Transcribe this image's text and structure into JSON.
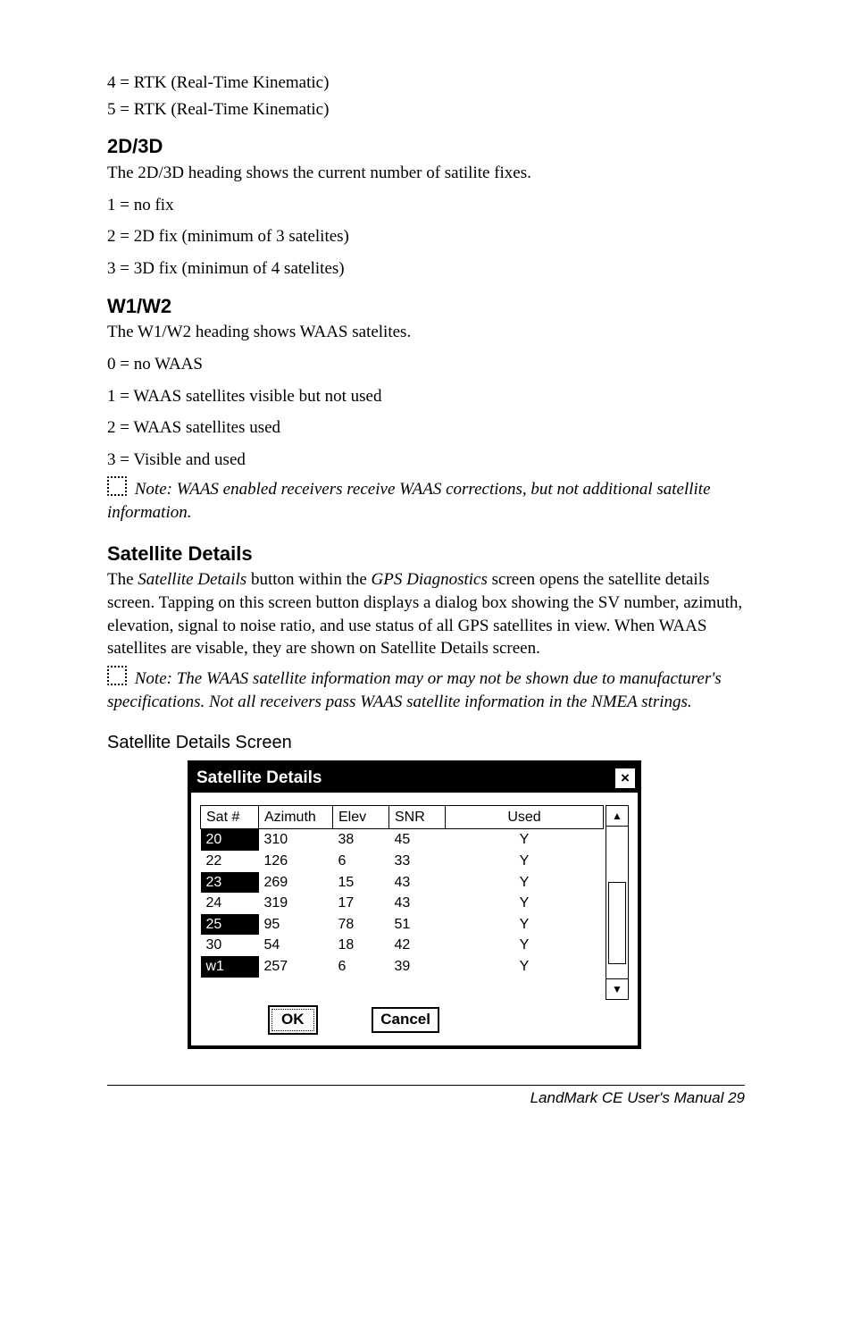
{
  "lines": {
    "rtk4": "4 = RTK (Real-Time Kinematic)",
    "rtk5": "5 = RTK (Real-Time Kinematic)"
  },
  "sec2d3d": {
    "heading": "2D/3D",
    "intro": "The 2D/3D heading shows the current number of satilite fixes.",
    "l1": "1 = no fix",
    "l2": "2 = 2D fix (minimum of 3 satelites)",
    "l3": "3 = 3D fix (minimun of 4 satelites)"
  },
  "secw": {
    "heading": "W1/W2",
    "intro": "The W1/W2 heading shows WAAS satelites.",
    "l0": "0 = no WAAS",
    "l1": "1 = WAAS satellites visible but not used",
    "l2": "2 = WAAS satellites used",
    "l3": "3 = Visible and used",
    "note": " Note: WAAS enabled receivers receive WAAS corrections, but not additional satellite information."
  },
  "secdetails": {
    "heading": "Satellite Details",
    "p1a": "The ",
    "p1b": "Satellite Details",
    "p1c": " button within the ",
    "p1d": "GPS Diagnostics",
    "p1e": " screen opens the satellite details screen. Tapping on this screen button displays a dialog box showing the SV number, azimuth, elevation, signal to noise ratio, and use status of all GPS satellites in view. When WAAS satellites are visable, they are shown on Satellite Details screen.",
    "note": " Note: The WAAS satellite information may or may not be shown due to manufacturer's specifications. Not all receivers pass WAAS satellite information in the NMEA strings.",
    "screentitle": "Satellite Details Screen"
  },
  "dialog": {
    "title": "Satellite Details",
    "close": "×",
    "headers": {
      "sat": "Sat #",
      "az": "Azimuth",
      "elev": "Elev",
      "snr": "SNR",
      "used": "Used"
    },
    "rows": [
      {
        "sat": "20",
        "sel": true,
        "az": "310",
        "elev": "38",
        "snr": "45",
        "used": "Y"
      },
      {
        "sat": "22",
        "sel": false,
        "az": "126",
        "elev": "6",
        "snr": "33",
        "used": "Y"
      },
      {
        "sat": "23",
        "sel": true,
        "az": "269",
        "elev": "15",
        "snr": "43",
        "used": "Y"
      },
      {
        "sat": "24",
        "sel": false,
        "az": "319",
        "elev": "17",
        "snr": "43",
        "used": "Y"
      },
      {
        "sat": "25",
        "sel": true,
        "az": "95",
        "elev": "78",
        "snr": "51",
        "used": "Y"
      },
      {
        "sat": "30",
        "sel": false,
        "az": "54",
        "elev": "18",
        "snr": "42",
        "used": "Y"
      },
      {
        "sat": "w1",
        "sel": true,
        "az": "257",
        "elev": "6",
        "snr": "39",
        "used": "Y"
      }
    ],
    "ok": "OK",
    "cancel": "Cancel",
    "up": "▲",
    "down": "▼"
  },
  "footer": "LandMark CE User's Manual  29"
}
